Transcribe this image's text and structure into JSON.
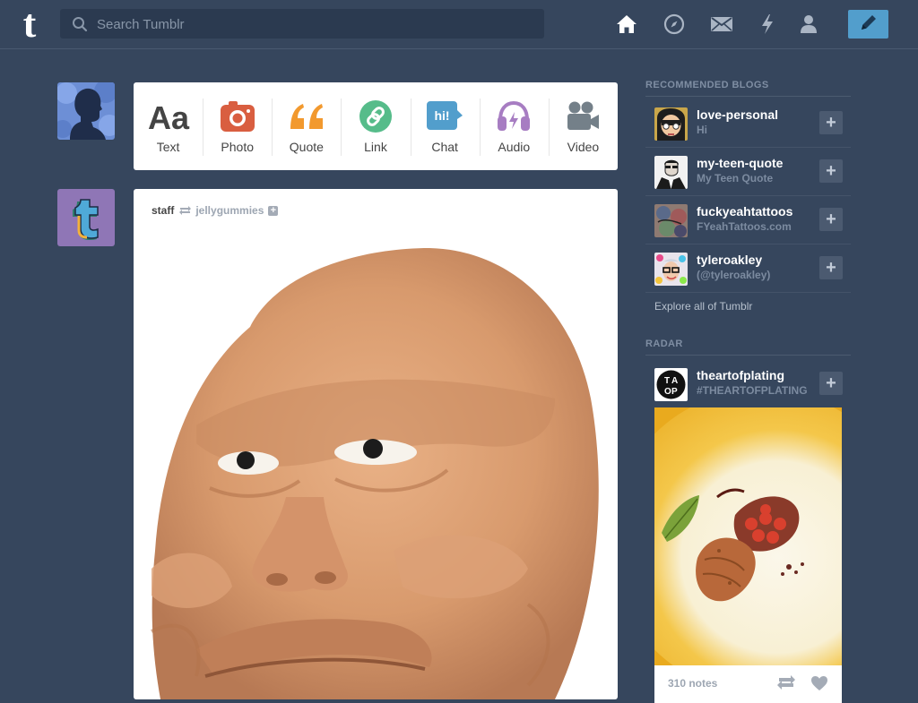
{
  "search": {
    "placeholder": "Search Tumblr"
  },
  "nav": {
    "icons": [
      "home-icon",
      "explore-compass-icon",
      "inbox-mail-icon",
      "activity-lightning-icon",
      "account-person-icon",
      "compose-pencil-icon"
    ]
  },
  "post_types": [
    {
      "label": "Text",
      "icon": "text-aa-icon",
      "color": "#444444"
    },
    {
      "label": "Photo",
      "icon": "camera-icon",
      "color": "#d95e40"
    },
    {
      "label": "Quote",
      "icon": "quote-icon",
      "color": "#f2992e"
    },
    {
      "label": "Link",
      "icon": "link-icon",
      "color": "#56bc8a"
    },
    {
      "label": "Chat",
      "icon": "chat-bubble-icon",
      "color": "#529ecc"
    },
    {
      "label": "Audio",
      "icon": "headphones-icon",
      "color": "#a77dc2"
    },
    {
      "label": "Video",
      "icon": "video-camera-icon",
      "color": "#748089"
    }
  ],
  "post": {
    "author": "staff",
    "reblogged_from": "jellygummies",
    "follow": "+"
  },
  "sidebar": {
    "recommended_heading": "RECOMMENDED BLOGS",
    "recommended": [
      {
        "name": "love-personal",
        "title": "Hi"
      },
      {
        "name": "my-teen-quote",
        "title": "My Teen Quote"
      },
      {
        "name": "fuckyeahtattoos",
        "title": "FYeahTattoos.com"
      },
      {
        "name": "tyleroakley",
        "title": "(@tyleroakley)"
      }
    ],
    "follow_glyph": "+",
    "explore": "Explore all of Tumblr",
    "radar_heading": "RADAR",
    "radar": {
      "name": "theartofplating",
      "title": "#THEARTOFPLATING",
      "notes": "310 notes"
    }
  },
  "colors": {
    "background": "#36465d",
    "accent": "#529ecc"
  }
}
